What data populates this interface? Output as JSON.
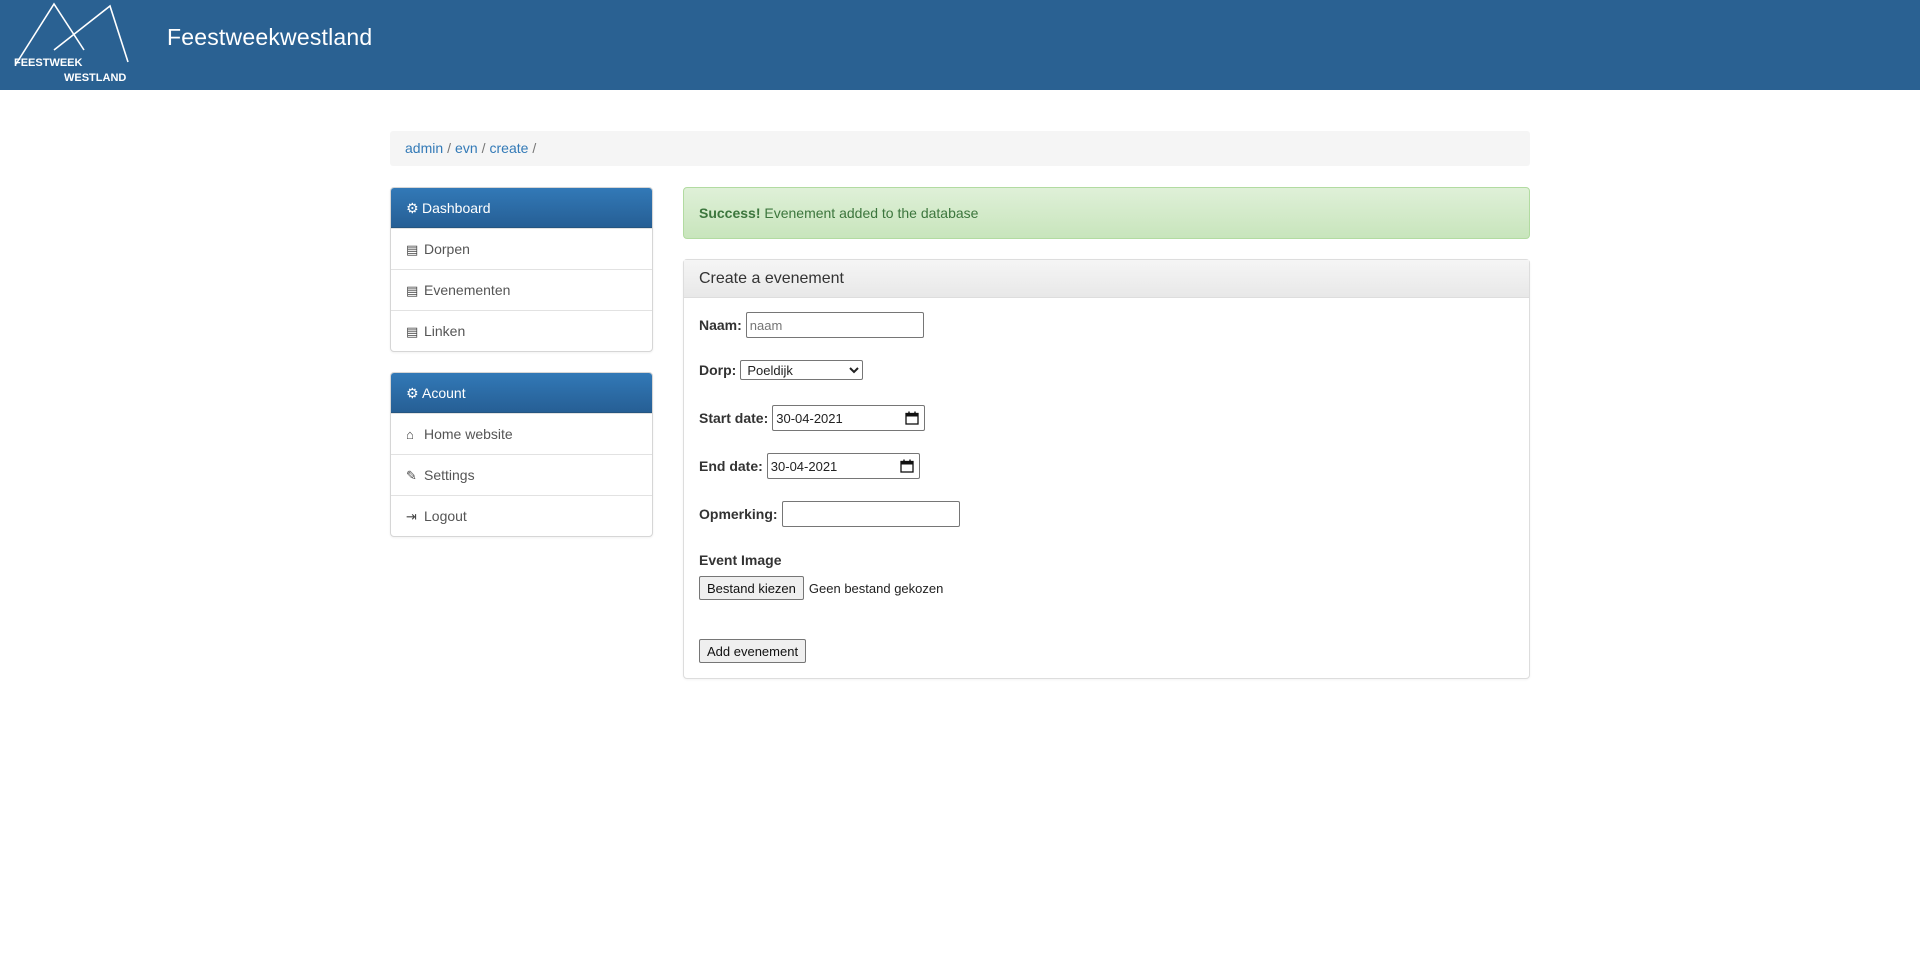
{
  "site": {
    "title": "Feestweekwestland",
    "logo_text_1": "FEESTWEEK",
    "logo_text_2": "WESTLAND"
  },
  "breadcrumb": [
    {
      "label": "admin"
    },
    {
      "label": "evn"
    },
    {
      "label": "create"
    }
  ],
  "breadcrumb_separator": "/",
  "sidebar": {
    "dashboard": {
      "title": "Dashboard",
      "icon": "gear-icon",
      "items": [
        {
          "label": "Dorpen",
          "icon": "list-icon"
        },
        {
          "label": "Evenementen",
          "icon": "list-icon"
        },
        {
          "label": "Linken",
          "icon": "list-icon"
        }
      ]
    },
    "account": {
      "title": "Acount",
      "icon": "gear-icon",
      "items": [
        {
          "label": "Home website",
          "icon": "home-icon"
        },
        {
          "label": "Settings",
          "icon": "pencil-icon"
        },
        {
          "label": "Logout",
          "icon": "logout-icon"
        }
      ]
    }
  },
  "alert": {
    "strong": "Success!",
    "message": "Evenement added to the database"
  },
  "form": {
    "title": "Create a evenement",
    "naam_label": "Naam:",
    "naam_placeholder": "naam",
    "naam_value": "",
    "dorp_label": "Dorp:",
    "dorp_selected": "Poeldijk",
    "start_label": "Start date:",
    "start_value": "30-04-2021",
    "end_label": "End date:",
    "end_value": "30-04-2021",
    "opmerking_label": "Opmerking:",
    "opmerking_value": "",
    "image_label": "Event Image",
    "file_button": "Bestand kiezen",
    "file_status": "Geen bestand gekozen",
    "submit_label": "Add evenement"
  },
  "colors": {
    "header_bg": "#2a6192",
    "link": "#337ab7",
    "panel_primary": "#2d6da8",
    "success_text": "#3c763d",
    "success_bg": "#dff0d8"
  }
}
